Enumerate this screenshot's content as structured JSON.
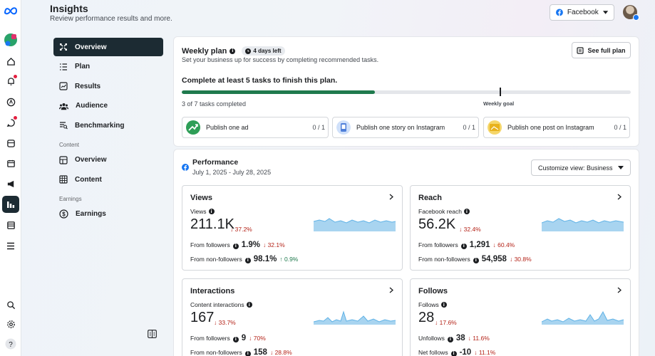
{
  "app": {
    "title": "Insights",
    "subtitle": "Review performance results and more.",
    "account_selector": "Facebook"
  },
  "rail": {
    "icons": [
      "meta-logo-icon",
      "profile-avatar-icon",
      "home-icon",
      "notifications-icon",
      "create-icon",
      "messages-icon",
      "posts-icon",
      "calendar-icon",
      "ads-icon",
      "insights-icon",
      "pages-icon",
      "menu-icon",
      "search-icon",
      "settings-icon",
      "help-icon"
    ]
  },
  "nav": {
    "main": [
      {
        "label": "Overview",
        "icon": "overview-icon",
        "active": true
      },
      {
        "label": "Plan",
        "icon": "plan-list-icon"
      },
      {
        "label": "Results",
        "icon": "results-chart-icon"
      },
      {
        "label": "Audience",
        "icon": "audience-icon"
      },
      {
        "label": "Benchmarking",
        "icon": "benchmarking-icon"
      }
    ],
    "content_section": "Content",
    "content": [
      {
        "label": "Overview",
        "icon": "content-overview-icon"
      },
      {
        "label": "Content",
        "icon": "content-grid-icon"
      }
    ],
    "earnings_section": "Earnings",
    "earnings": [
      {
        "label": "Earnings",
        "icon": "dollar-icon"
      }
    ]
  },
  "plan": {
    "title": "Weekly plan",
    "days_left": "4 days left",
    "subtitle": "Set your business up for success by completing recommended tasks.",
    "see_full": "See full plan",
    "heading": "Complete at least 5 tasks to finish this plan.",
    "progress": 0.43,
    "goal_position": 0.71,
    "tasks_completed": "3 of 7 tasks completed",
    "goal_label": "Weekly goal",
    "tasks": [
      {
        "label": "Publish one ad",
        "count": "0 / 1",
        "color": "#2e9e57"
      },
      {
        "label": "Publish one story on Instagram",
        "count": "0 / 1",
        "color": "#4f7fd9"
      },
      {
        "label": "Publish one post on Instagram",
        "count": "0 / 1",
        "color": "#e8b21d"
      }
    ]
  },
  "performance": {
    "title": "Performance",
    "date_range": "July 1, 2025 - July 28, 2025",
    "customize": "Customize view: Business",
    "metrics": [
      {
        "title": "Views",
        "label": "Views",
        "value": "211.1K",
        "delta": "37.2%",
        "delta_dir": "down",
        "rows": [
          {
            "label": "From followers",
            "value": "1.9%",
            "delta": "32.1%",
            "dir": "down"
          },
          {
            "label": "From non-followers",
            "value": "98.1%",
            "delta": "0.9%",
            "dir": "up"
          }
        ]
      },
      {
        "title": "Reach",
        "label": "Facebook reach",
        "value": "56.2K",
        "delta": "32.4%",
        "delta_dir": "down",
        "rows": [
          {
            "label": "From followers",
            "value": "1,291",
            "delta": "60.4%",
            "dir": "down"
          },
          {
            "label": "From non-followers",
            "value": "54,958",
            "delta": "30.8%",
            "dir": "down"
          }
        ]
      },
      {
        "title": "Interactions",
        "label": "Content interactions",
        "value": "167",
        "delta": "33.7%",
        "delta_dir": "down",
        "rows": [
          {
            "label": "From followers",
            "value": "9",
            "delta": "70%",
            "dir": "down"
          },
          {
            "label": "From non-followers",
            "value": "158",
            "delta": "28.8%",
            "dir": "down"
          }
        ]
      },
      {
        "title": "Follows",
        "label": "Follows",
        "value": "28",
        "delta": "17.6%",
        "delta_dir": "down",
        "rows": [
          {
            "label": "Unfollows",
            "value": "38",
            "delta": "11.6%",
            "dir": "down"
          },
          {
            "label": "Net follows",
            "value": "-10",
            "delta": "11.1%",
            "dir": "down"
          }
        ]
      }
    ]
  },
  "colors": {
    "dark_nav": "#1c2b33",
    "progress": "#1f7a4d",
    "down": "#b42318",
    "up": "#1f7a4d",
    "spark_fill": "#a8d4f0",
    "spark_line": "#5fb2e6"
  }
}
